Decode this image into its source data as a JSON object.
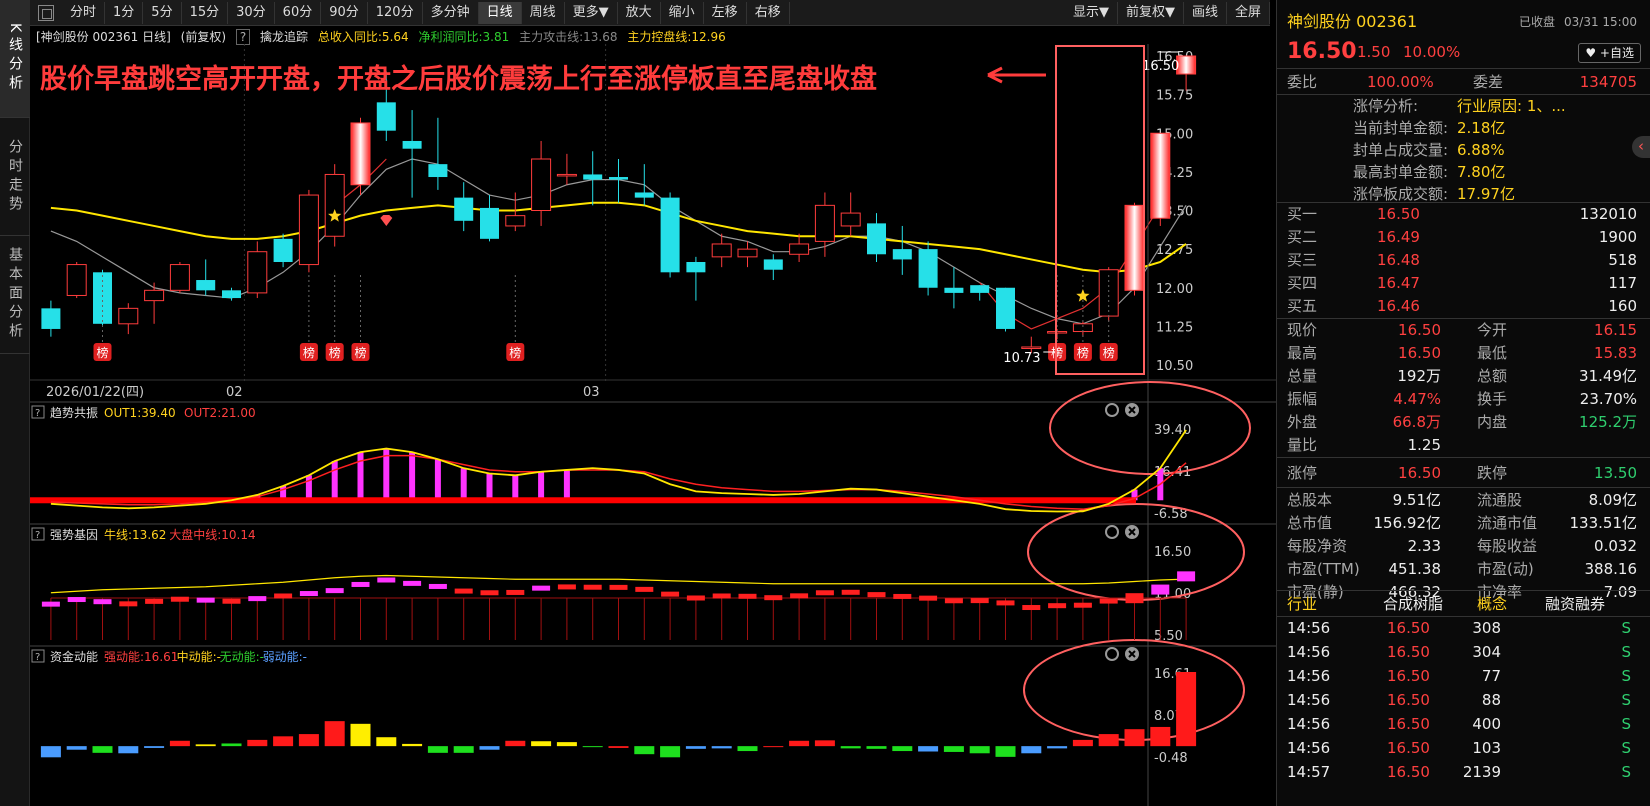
{
  "left_tabs": [
    "K线分析",
    "分时走势",
    "基本面分析"
  ],
  "toolbar": {
    "periods": [
      "分时",
      "1分",
      "5分",
      "15分",
      "30分",
      "60分",
      "90分",
      "120分",
      "多分钟",
      "日线",
      "周线",
      "更多▼"
    ],
    "active_period": "日线",
    "actions": [
      "放大",
      "缩小",
      "左移",
      "右移"
    ],
    "right": [
      "显示▼",
      "前复权▼",
      "画线",
      "全屏"
    ]
  },
  "info": {
    "stock": "[神剑股份 002361 日线]",
    "fq": "(前复权)",
    "q": "?",
    "indicator": "擒龙追踪",
    "rev": "总收入同比:5.64",
    "profit": "净利润同比:3.81",
    "attack": "主力攻击线:13.68",
    "control": "主力控盘线:12.96"
  },
  "annotation": "股价早盘跳空高开开盘，开盘之后股价震荡上行至涨停板直至尾盘收盘",
  "price_labels": {
    "high": "16.50",
    "low": "10.73"
  },
  "date_axis": {
    "first": "2026/01/22(四)",
    "m2": "02",
    "m3": "03"
  },
  "board_label": "榜",
  "sub_panels": [
    {
      "title": "趋势共振",
      "items": [
        {
          "t": "OUT1:39.40",
          "c": "#ffd21f"
        },
        {
          "t": "OUT2:21.00",
          "c": "#ff4040"
        }
      ],
      "axis": [
        "39.40",
        "16.41",
        "-6.58"
      ]
    },
    {
      "title": "强势基因",
      "items": [
        {
          "t": "牛线:13.62",
          "c": "#ffd21f"
        },
        {
          "t": "大盘中线:10.14",
          "c": "#ff4040"
        }
      ],
      "axis": [
        "16.50",
        "11.00",
        "5.50"
      ]
    },
    {
      "title": "资金动能",
      "items": [
        {
          "t": "强动能:16.61",
          "c": "#ff4040"
        },
        {
          "t": "中动能:-",
          "c": "#ffd21f"
        },
        {
          "t": "无动能:-",
          "c": "#2fcf2f"
        },
        {
          "t": "弱动能:-",
          "c": "#5aa0ff"
        }
      ],
      "axis": [
        "16.61",
        "8.07",
        "-0.48"
      ]
    }
  ],
  "chart_data": {
    "type": "candlestick",
    "ylim": [
      10.5,
      16.5
    ],
    "y_ticks": [
      "16.50",
      "15.75",
      "15.00",
      "14.25",
      "13.50",
      "12.75",
      "12.00",
      "11.25",
      "10.50"
    ],
    "candles": [
      [
        11.6,
        11.2,
        11.75,
        11.05
      ],
      [
        11.85,
        12.45,
        12.5,
        11.8
      ],
      [
        12.3,
        11.3,
        12.35,
        11.25
      ],
      [
        11.3,
        11.6,
        11.7,
        11.1
      ],
      [
        11.75,
        11.95,
        12.1,
        11.3
      ],
      [
        11.95,
        12.45,
        12.5,
        11.9
      ],
      [
        12.15,
        11.95,
        12.55,
        11.85
      ],
      [
        11.95,
        11.8,
        12.0,
        11.75
      ],
      [
        11.9,
        12.7,
        12.9,
        11.8
      ],
      [
        12.95,
        12.5,
        13.05,
        12.4
      ],
      [
        12.45,
        13.8,
        13.9,
        12.3
      ],
      [
        13.0,
        14.2,
        14.4,
        12.8
      ],
      [
        14.0,
        15.2,
        15.3,
        13.8
      ],
      [
        15.6,
        15.05,
        16.2,
        14.85
      ],
      [
        14.85,
        14.7,
        15.45,
        13.75
      ],
      [
        14.4,
        14.15,
        15.3,
        13.9
      ],
      [
        13.75,
        13.3,
        14.05,
        13.1
      ],
      [
        13.55,
        12.95,
        13.8,
        12.9
      ],
      [
        13.2,
        13.4,
        13.85,
        13.1
      ],
      [
        13.5,
        14.5,
        14.85,
        13.2
      ],
      [
        14.2,
        14.2,
        14.6,
        14.0
      ],
      [
        14.2,
        14.1,
        14.65,
        13.6
      ],
      [
        14.15,
        14.1,
        14.5,
        13.65
      ],
      [
        13.85,
        13.75,
        14.4,
        13.6
      ],
      [
        13.75,
        12.3,
        13.85,
        12.2
      ],
      [
        12.5,
        12.3,
        12.6,
        11.75
      ],
      [
        12.6,
        12.85,
        13.05,
        12.4
      ],
      [
        12.6,
        12.75,
        12.9,
        12.4
      ],
      [
        12.55,
        12.35,
        12.65,
        12.15
      ],
      [
        12.65,
        12.85,
        13.05,
        12.5
      ],
      [
        12.9,
        13.6,
        13.85,
        12.6
      ],
      [
        13.2,
        13.45,
        13.85,
        13.0
      ],
      [
        13.25,
        12.65,
        13.45,
        12.5
      ],
      [
        12.75,
        12.55,
        13.2,
        12.25
      ],
      [
        12.75,
        12.0,
        12.9,
        11.85
      ],
      [
        12.0,
        11.9,
        12.4,
        11.6
      ],
      [
        12.05,
        11.9,
        12.05,
        11.75
      ],
      [
        12.0,
        11.2,
        12.0,
        11.15
      ],
      [
        10.85,
        10.85,
        11.05,
        10.73
      ],
      [
        11.15,
        11.15,
        11.2,
        11.0
      ],
      [
        11.15,
        11.3,
        11.35,
        11.05
      ],
      [
        11.45,
        12.35,
        12.4,
        11.35
      ],
      [
        11.95,
        13.6,
        13.65,
        11.85
      ],
      [
        13.35,
        15.0,
        15.0,
        13.2
      ],
      [
        16.15,
        16.5,
        16.5,
        15.83
      ]
    ],
    "ma_white": [
      13.1,
      12.9,
      12.6,
      12.3,
      12.0,
      11.9,
      11.85,
      11.8,
      12.0,
      12.3,
      12.7,
      13.2,
      13.8,
      14.3,
      14.5,
      14.4,
      14.1,
      13.8,
      13.7,
      13.8,
      14.0,
      14.1,
      14.1,
      14.0,
      13.6,
      13.3,
      13.0,
      12.9,
      12.7,
      12.7,
      12.8,
      13.0,
      13.0,
      12.9,
      12.7,
      12.4,
      12.1,
      11.85,
      11.6,
      11.4,
      11.3,
      11.5,
      12.0,
      12.8,
      13.6
    ],
    "ma_yellow": [
      13.55,
      13.5,
      13.4,
      13.3,
      13.2,
      13.1,
      13.0,
      12.95,
      12.95,
      13.0,
      13.1,
      13.25,
      13.4,
      13.5,
      13.55,
      13.6,
      13.55,
      13.5,
      13.5,
      13.55,
      13.6,
      13.65,
      13.65,
      13.6,
      13.45,
      13.3,
      13.2,
      13.1,
      13.05,
      13.0,
      13.0,
      13.0,
      12.95,
      12.9,
      12.85,
      12.8,
      12.75,
      12.65,
      12.55,
      12.45,
      12.35,
      12.3,
      12.35,
      12.5,
      12.85
    ],
    "board_idx": [
      2,
      10,
      11,
      12,
      18,
      39,
      40,
      41
    ],
    "star_idx": [
      11,
      40
    ],
    "diamond_idx": [
      13
    ],
    "trend": {
      "ylim": [
        -6.58,
        39.4
      ],
      "out1": [
        -2,
        -3,
        -4,
        -4.5,
        -4,
        -3,
        -2,
        0,
        3,
        8,
        14,
        22,
        27,
        29,
        27,
        23,
        18,
        15,
        14,
        16,
        17,
        18,
        17,
        15,
        9,
        5,
        4,
        3.5,
        3,
        3.5,
        5,
        6.5,
        6,
        4,
        2,
        0,
        -2,
        -5,
        -6,
        -6.3,
        -6.2,
        -2,
        6,
        18,
        39.4
      ],
      "out2": [
        -1,
        -1.5,
        -2,
        -2.5,
        -2.5,
        -2,
        -1,
        0,
        2,
        6,
        11,
        17,
        22,
        25,
        25,
        23,
        20,
        17,
        16,
        16,
        17,
        17,
        17,
        16,
        12,
        9,
        7,
        6,
        5,
        5,
        5.5,
        6,
        6,
        5,
        3.5,
        2,
        0,
        -2,
        -3.5,
        -4.5,
        -5,
        -3,
        1,
        9,
        21
      ],
      "bars": [
        8,
        9,
        10,
        11,
        12,
        13,
        14,
        15,
        16,
        17,
        18,
        19,
        20,
        42,
        43
      ]
    },
    "strong": {
      "ylim": [
        5.5,
        17.5
      ],
      "niu": [
        11.8,
        12.0,
        12.2,
        12.3,
        12.4,
        12.5,
        12.6,
        12.8,
        13.0,
        13.2,
        13.5,
        13.8,
        14.0,
        14.1,
        14.0,
        13.9,
        13.8,
        13.7,
        13.6,
        13.6,
        13.6,
        13.6,
        13.6,
        13.5,
        13.4,
        13.3,
        13.2,
        13.1,
        13.0,
        13.0,
        13.0,
        13.0,
        13.0,
        13.0,
        13.0,
        13.0,
        13.0,
        13.0,
        13.0,
        13.0,
        13.0,
        13.1,
        13.3,
        13.5,
        13.62
      ],
      "colors": [
        "m",
        "m",
        "m",
        "r",
        "r",
        "r",
        "m",
        "r",
        "m",
        "r",
        "m",
        "m",
        "m",
        "m",
        "m",
        "m",
        "r",
        "r",
        "r",
        "m",
        "r",
        "r",
        "r",
        "r",
        "r",
        "r",
        "r",
        "r",
        "r",
        "r",
        "r",
        "r",
        "r",
        "r",
        "r",
        "r",
        "r",
        "r",
        "r",
        "r",
        "r",
        "r",
        "r",
        "m",
        "m"
      ]
    },
    "fund": {
      "ylim": [
        -0.48,
        16.61
      ],
      "values": [
        -2.5,
        -0.8,
        -1.5,
        -1.6,
        -0.4,
        1.2,
        0.4,
        0.6,
        1.4,
        2.2,
        2.7,
        5.6,
        5.0,
        2.0,
        0.5,
        -1.5,
        -1.5,
        -0.8,
        1.2,
        1.1,
        0.9,
        -0.2,
        -0.4,
        -1.8,
        -2.5,
        -0.6,
        -0.5,
        -1.1,
        -0.2,
        1.2,
        1.3,
        -0.5,
        -0.6,
        -1.1,
        -1.2,
        -1.3,
        -1.6,
        -2.4,
        -1.6,
        -0.5,
        1.4,
        2.7,
        3.8,
        4.3,
        16.61
      ],
      "colors": [
        "b",
        "b",
        "g",
        "b",
        "b",
        "r",
        "y",
        "g",
        "r",
        "r",
        "r",
        "r",
        "y",
        "y",
        "y",
        "g",
        "g",
        "b",
        "r",
        "y",
        "y",
        "g",
        "r",
        "g",
        "g",
        "b",
        "b",
        "g",
        "r",
        "r",
        "r",
        "g",
        "g",
        "g",
        "b",
        "g",
        "g",
        "g",
        "b",
        "b",
        "r",
        "r",
        "r",
        "r",
        "r"
      ]
    }
  },
  "right": {
    "name": "神剑股份 002361",
    "status": "已收盘",
    "datetime": "03/31 15:00",
    "price": "16.50",
    "change": "1.50",
    "pct": "10.00%",
    "watch": "♥ +自选",
    "wb_label": "委比",
    "wb": "100.00%",
    "wc_label": "委差",
    "wc": "134705",
    "limit": [
      [
        "涨停分析:",
        "行业原因: 1、..."
      ],
      [
        "当前封单金额:",
        "2.18亿"
      ],
      [
        "封单占成交量:",
        "6.88%"
      ],
      [
        "最高封单金额:",
        "7.80亿"
      ],
      [
        "涨停板成交额:",
        "17.97亿"
      ]
    ],
    "bids": [
      [
        "买一",
        "16.50",
        "132010"
      ],
      [
        "买二",
        "16.49",
        "1900"
      ],
      [
        "买三",
        "16.48",
        "518"
      ],
      [
        "买四",
        "16.47",
        "117"
      ],
      [
        "买五",
        "16.46",
        "160"
      ]
    ],
    "quote": [
      [
        [
          "现价",
          "16.50",
          "red"
        ],
        [
          "今开",
          "16.15",
          "red"
        ]
      ],
      [
        [
          "最高",
          "16.50",
          "red"
        ],
        [
          "最低",
          "15.83",
          "red"
        ]
      ],
      [
        [
          "总量",
          "192万",
          "wht"
        ],
        [
          "总额",
          "31.49亿",
          "wht"
        ]
      ],
      [
        [
          "振幅",
          "4.47%",
          "red"
        ],
        [
          "换手",
          "23.70%",
          "wht"
        ]
      ],
      [
        [
          "外盘",
          "66.8万",
          "red"
        ],
        [
          "内盘",
          "125.2万",
          "grn"
        ]
      ],
      [
        [
          "量比",
          "1.25",
          "wht"
        ]
      ],
      [
        [
          "涨停",
          "16.50",
          "red"
        ],
        [
          "跌停",
          "13.50",
          "grn"
        ]
      ],
      [
        [
          "总股本",
          "9.51亿",
          "wht"
        ],
        [
          "流通股",
          "8.09亿",
          "wht"
        ]
      ],
      [
        [
          "总市值",
          "156.92亿",
          "wht"
        ],
        [
          "流通市值",
          "133.51亿",
          "wht"
        ]
      ],
      [
        [
          "每股净资",
          "2.33",
          "wht"
        ],
        [
          "每股收益",
          "0.032",
          "wht"
        ]
      ],
      [
        [
          "市盈(TTM)",
          "451.38",
          "wht"
        ],
        [
          "市盈(动)",
          "388.16",
          "wht"
        ]
      ],
      [
        [
          "市盈(静)",
          "466.32",
          "wht"
        ],
        [
          "市净率",
          "7.09",
          "wht"
        ]
      ]
    ],
    "tabs": [
      "行业",
      "合成树脂",
      "概念",
      "融资融券"
    ],
    "ticks": [
      [
        "14:56",
        "16.50",
        "308",
        "S"
      ],
      [
        "14:56",
        "16.50",
        "304",
        "S"
      ],
      [
        "14:56",
        "16.50",
        "77",
        "S"
      ],
      [
        "14:56",
        "16.50",
        "88",
        "S"
      ],
      [
        "14:56",
        "16.50",
        "400",
        "S"
      ],
      [
        "14:56",
        "16.50",
        "103",
        "S"
      ],
      [
        "14:57",
        "16.50",
        "2139",
        "S"
      ]
    ]
  }
}
